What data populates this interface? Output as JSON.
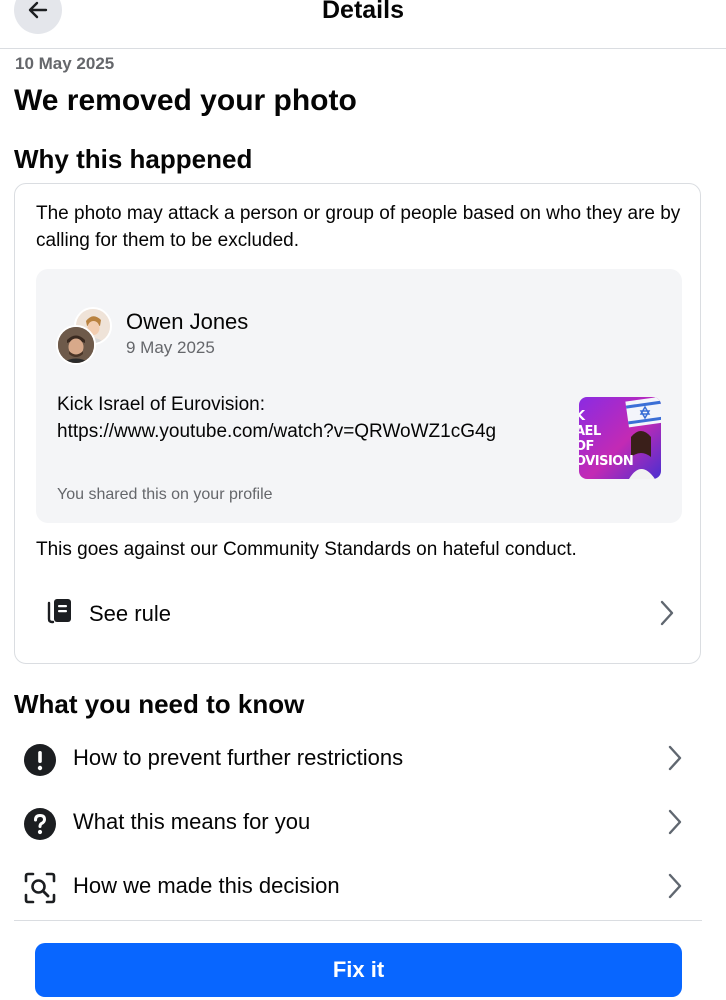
{
  "header": {
    "title": "Details",
    "back_icon": "arrow-left-icon"
  },
  "notice": {
    "date": "10 May 2025",
    "title": "We removed your photo"
  },
  "why": {
    "heading": "Why this happened",
    "reason": "The photo may attack a person or group of people based on who they are by calling for them to be excluded.",
    "post": {
      "author": "Owen Jones",
      "date": "9 May 2025",
      "text_line1": "Kick Israel of Eurovision:",
      "text_line2": "https://www.youtube.com/watch?v=QRWoWZ1cG4g",
      "shared_note": "You shared this on your profile",
      "thumbnail_lines": [
        "K",
        "AEL",
        "OF",
        "OVISION"
      ]
    },
    "against": "This goes against our Community Standards on hateful conduct.",
    "see_rule_label": "See rule"
  },
  "know": {
    "heading": "What you need to know",
    "items": [
      {
        "label": "How to prevent further restrictions",
        "icon": "exclamation-circle-icon"
      },
      {
        "label": "What this means for you",
        "icon": "question-circle-icon"
      },
      {
        "label": "How we made this decision",
        "icon": "magnify-scan-icon"
      }
    ]
  },
  "actions": {
    "fix_label": "Fix it"
  },
  "colors": {
    "accent": "#0866ff",
    "secondary_text": "#65676b",
    "divider": "#dadde1",
    "post_bg": "#f4f5f7"
  }
}
